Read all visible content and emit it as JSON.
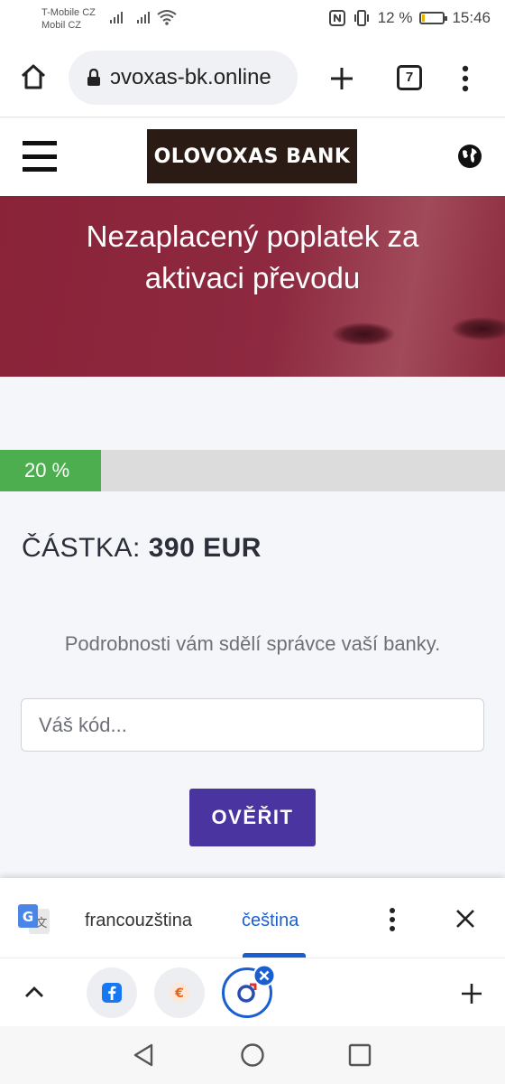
{
  "status_bar": {
    "carrier_line1": "T-Mobile CZ",
    "carrier_line2": "Mobil CZ",
    "battery": "12 %",
    "time": "15:46",
    "battery_level": 0.12
  },
  "browser": {
    "url": "ɔvoxas-bk.online",
    "tab_count": "7"
  },
  "site": {
    "logo_text": "OLOVOXAS BANK",
    "hero_title": "Nezaplacený poplatek za aktivaci převodu",
    "progress_label": "20 %",
    "progress_value": 0.2,
    "amount_label": "ČÁSTKA:",
    "amount_value": "390 EUR",
    "info_text": "Podrobnosti vám sdělí správce vaší banky.",
    "code_placeholder": "Váš kód...",
    "verify_label": "OVĚŘIT"
  },
  "translate_bar": {
    "source_language": "francouzština",
    "target_language": "čeština"
  },
  "colors": {
    "hero": "#8a2338",
    "progress": "#4cae4f",
    "button": "#4a35a0",
    "translate_active": "#1a5fd1",
    "logo_bg": "#2a1b15"
  }
}
